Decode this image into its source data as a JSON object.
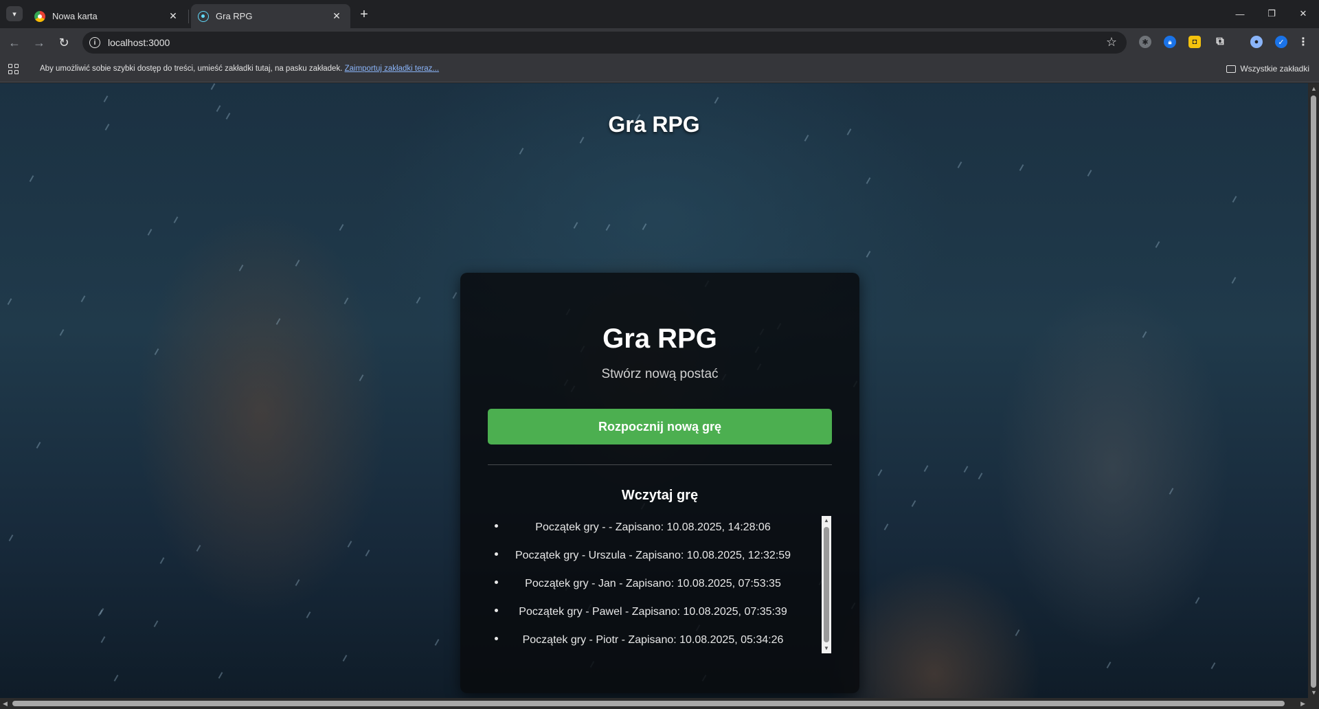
{
  "browser": {
    "tabs": [
      {
        "title": "Nowa karta",
        "active": false
      },
      {
        "title": "Gra RPG",
        "active": true
      }
    ],
    "url": "localhost:3000",
    "bookmarks_bar": {
      "message": "Aby umożliwić sobie szybki dostęp do treści, umieść zakładki tutaj, na pasku zakładek.",
      "import_link": "Zaimportuj zakładki teraz...",
      "all_bookmarks": "Wszystkie zakładki"
    },
    "icons": {
      "tab_menu": "chevron-down-icon",
      "new_tab": "plus-icon",
      "back": "arrow-left-icon",
      "forward": "arrow-right-icon",
      "reload": "reload-icon",
      "site_info": "info-icon",
      "bookmark": "star-icon",
      "extensions": "puzzle-icon",
      "menu": "kebab-menu-icon"
    }
  },
  "page": {
    "heading": "Gra RPG",
    "card": {
      "title": "Gra RPG",
      "subtitle": "Stwórz nową postać",
      "new_game_button": "Rozpocznij nową grę",
      "load_title": "Wczytaj grę",
      "saves": [
        "Początek gry - - Zapisano: 10.08.2025, 14:28:06",
        "Początek gry - Urszula - Zapisano: 10.08.2025, 12:32:59",
        "Początek gry - Jan - Zapisano: 10.08.2025, 07:53:35",
        "Początek gry - Pawel - Zapisano: 10.08.2025, 07:35:39",
        "Początek gry - Piotr - Zapisano: 10.08.2025, 05:34:26"
      ]
    },
    "colors": {
      "primary_button": "#4caf50",
      "card_background": "#080a0c"
    }
  }
}
